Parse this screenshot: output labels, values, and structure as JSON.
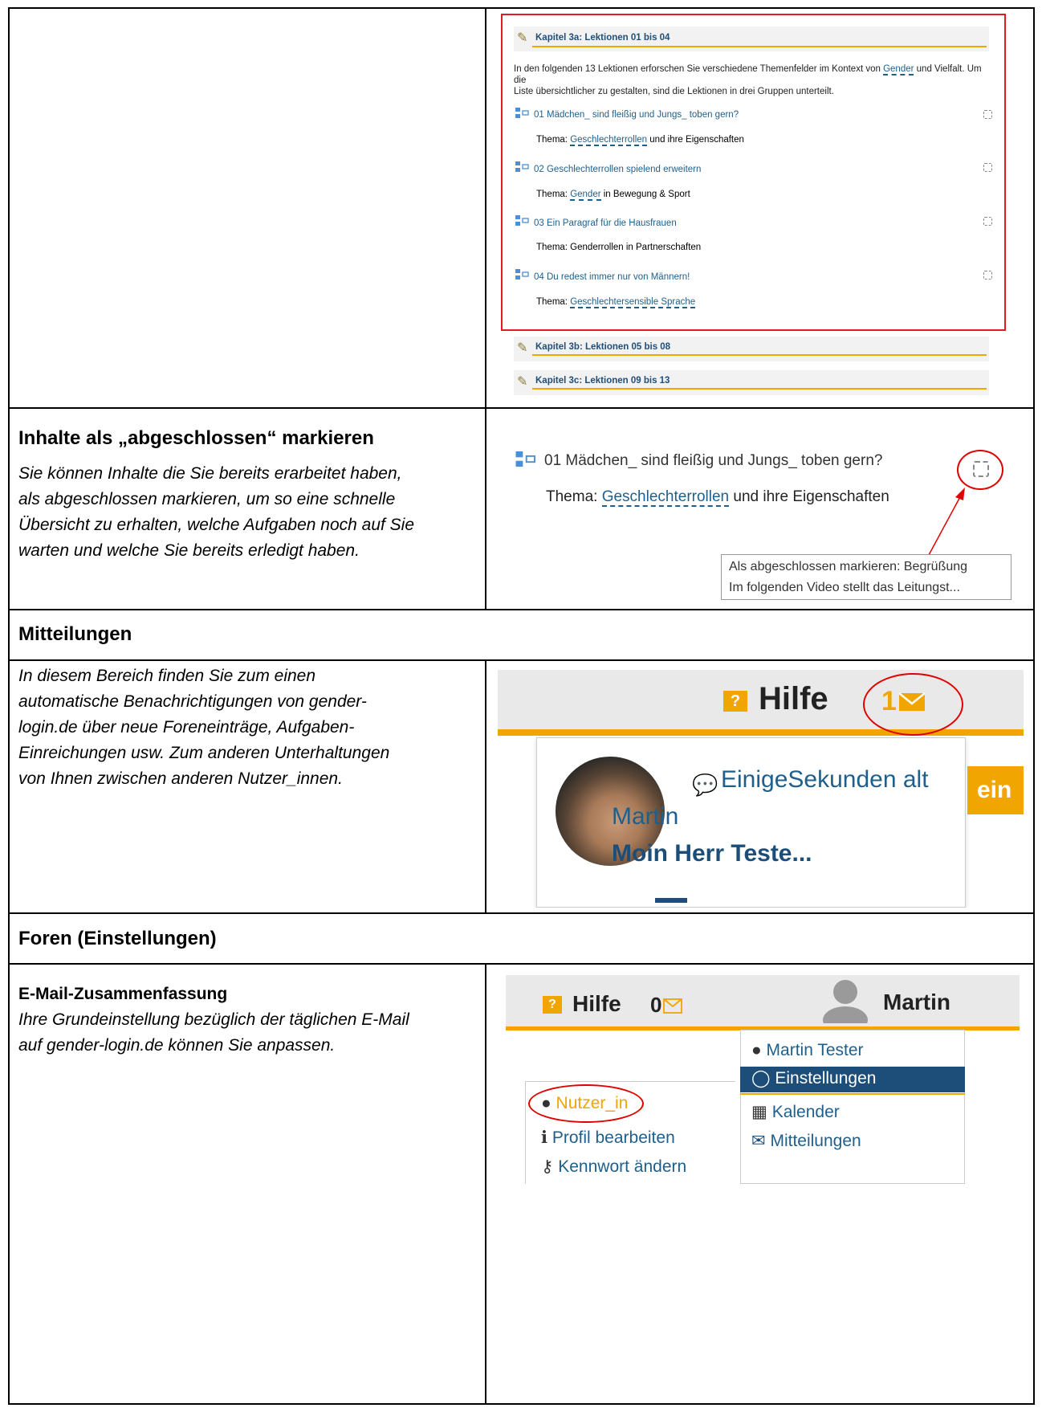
{
  "top_section": {
    "chapter_3a": "Kapitel 3a: Lektionen 01 bis 04",
    "intro_line1_pre": "In den folgenden 13 Lektionen erforschen Sie verschiedene Themenfelder im Kontext von ",
    "intro_link": "Gender",
    "intro_line1_post": " und Vielfalt. Um die",
    "intro_line2": "Liste übersichtlicher zu gestalten, sind die Lektionen in drei Gruppen unterteilt.",
    "lessons": [
      {
        "title": "01 Mädchen_ sind fleißig und Jungs_ toben gern?",
        "topic_prefix": "Thema: ",
        "topic_link": "Geschlechterrollen",
        "topic_suffix": " und ihre Eigenschaften"
      },
      {
        "title": "02 Geschlechterrollen spielend erweitern",
        "topic_prefix": "Thema: ",
        "topic_link": "Gender",
        "topic_suffix": " in Bewegung & Sport"
      },
      {
        "title": "03 Ein Paragraf für die Hausfrauen",
        "topic_prefix": "Thema: Genderrollen in Partnerschaften",
        "topic_link": "",
        "topic_suffix": ""
      },
      {
        "title": "04 Du redest immer nur von Männern!",
        "topic_prefix": "Thema: ",
        "topic_link": "Geschlechtersensible Sprache",
        "topic_suffix": ""
      }
    ],
    "chapter_3b": "Kapitel 3b: Lektionen 05 bis 08",
    "chapter_3c": "Kapitel 3c: Lektionen 09 bis 13"
  },
  "section_complete": {
    "title": "Inhalte als „abgeschlossen“ markieren",
    "desc": [
      "Sie können Inhalte die Sie bereits erarbeitet haben,",
      "als abgeschlossen markieren, um so eine schnelle",
      "Übersicht zu erhalten, welche Aufgaben noch auf Sie",
      "warten und welche Sie bereits erledigt haben."
    ],
    "lesson_title": "01 Mädchen_ sind fleißig und Jungs_ toben gern?",
    "topic_prefix": "Thema: ",
    "topic_link": "Geschlechterrollen",
    "topic_suffix": " und ihre Eigenschaften",
    "tooltip_line1": "Als abgeschlossen markieren: Begrüßung",
    "tooltip_line2": "Im folgenden Video stellt das Leitungst..."
  },
  "section_messages": {
    "title": "Mitteilungen",
    "desc": [
      "In diesem Bereich finden Sie zum einen",
      "automatische Benachrichtigungen von gender-",
      "login.de über neue Foreneinträge, Aufgaben-",
      "Einreichungen usw. Zum anderen Unterhaltungen",
      "von Ihnen zwischen anderen Nutzer_innen."
    ],
    "help_icon": "?",
    "help_label": "Hilfe",
    "msg_count": "1",
    "msg_time": "EinigeSekunden alt",
    "msg_sender": "Martin",
    "msg_preview": "Moin Herr Teste...",
    "cut_text": "ein"
  },
  "section_forums": {
    "title": "Foren (Einstellungen)",
    "sub_title": "E-Mail-Zusammenfassung",
    "desc": [
      "Ihre Grundeinstellung bezüglich der täglichen E-Mail",
      "auf gender-login.de können Sie anpassen."
    ],
    "help_icon": "?",
    "help_label": "Hilfe",
    "msg_count": "0",
    "user_name": "Martin",
    "dropdown": [
      "Martin Tester",
      "Einstellungen",
      "Kalender",
      "Mitteilungen"
    ],
    "left_menu": [
      "Nutzer_in",
      "Profil bearbeiten",
      "Kennwort ändern"
    ]
  },
  "colors": {
    "accent": "#f0a500",
    "link": "#1f5f8c",
    "highlight_red": "#e00000",
    "selected_bg": "#1d4e79"
  }
}
